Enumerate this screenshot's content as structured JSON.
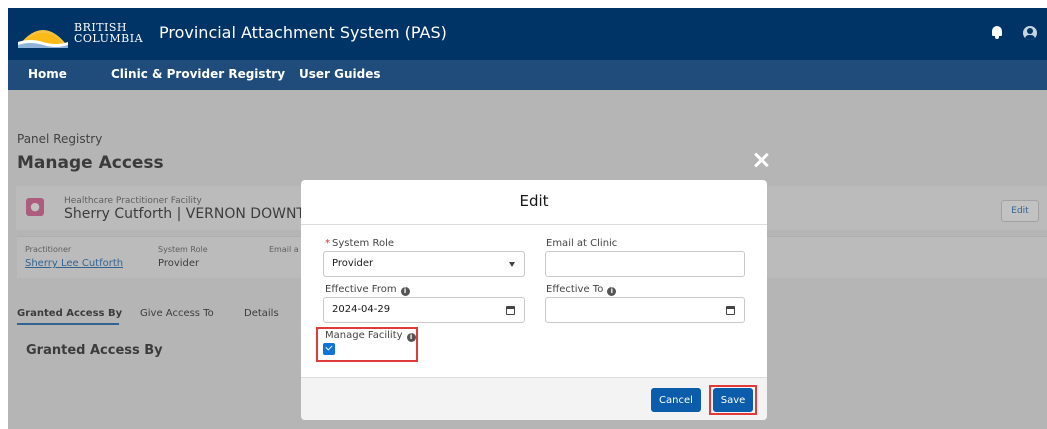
{
  "header": {
    "logo_line1": "BRITISH",
    "logo_line2": "COLUMBIA",
    "app_title": "Provincial Attachment System (PAS)",
    "icons": [
      "bell-icon",
      "user-icon"
    ]
  },
  "nav": {
    "items": [
      "Home",
      "Clinic & Provider Registry",
      "User Guides"
    ]
  },
  "page": {
    "breadcrumb": "Panel Registry",
    "title": "Manage Access",
    "record_type": "Healthcare Practitioner Facility",
    "record_name": "Sherry Cutforth | VERNON DOWNTO",
    "edit_button": "Edit",
    "fields": {
      "practitioner_label": "Practitioner",
      "practitioner_value": "Sherry Lee Cutforth",
      "system_role_label": "System Role",
      "system_role_value": "Provider",
      "email_label": "Email a"
    },
    "tabs": [
      "Granted Access By",
      "Give Access To",
      "Details"
    ],
    "section_title": "Granted Access By"
  },
  "modal": {
    "title": "Edit",
    "system_role_label": "System Role",
    "system_role_required": "*",
    "system_role_value": "Provider",
    "email_label": "Email at Clinic",
    "email_value": "",
    "effective_from_label": "Effective From",
    "effective_from_value": "2024-04-29",
    "effective_to_label": "Effective To",
    "effective_to_value": "",
    "manage_facility_label": "Manage Facility",
    "manage_facility_checked": true,
    "cancel_label": "Cancel",
    "save_label": "Save"
  },
  "colors": {
    "header_bg": "#003366",
    "nav_bg": "#1f4c7a",
    "brand_button": "#0b5cab",
    "highlight_red": "#e03a3a"
  }
}
